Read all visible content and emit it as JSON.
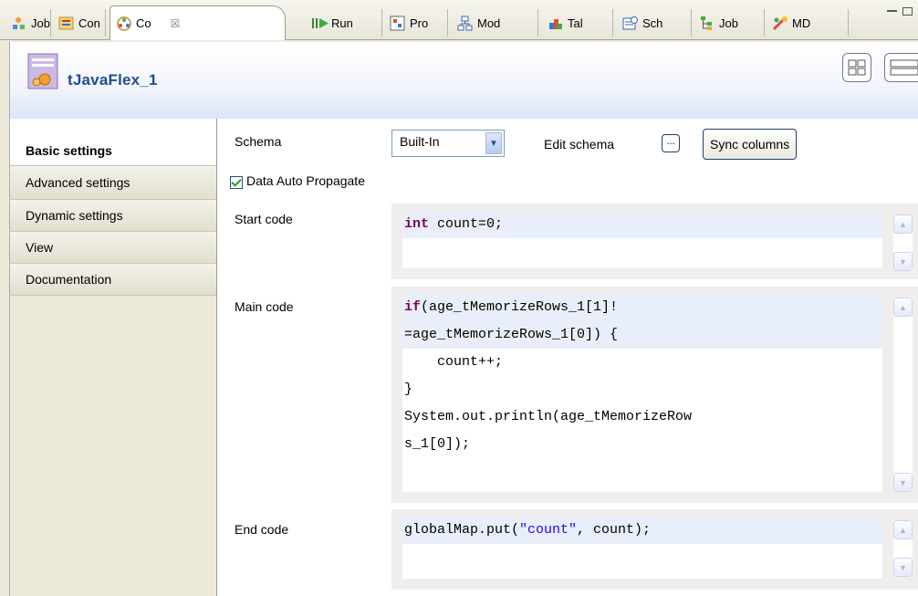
{
  "tabs": [
    {
      "label": "Job",
      "icon": "job-icon"
    },
    {
      "label": "Con",
      "icon": "contexts-icon"
    },
    {
      "label": "Co",
      "icon": "component-icon",
      "active": true
    },
    {
      "label": "Run",
      "icon": "run-icon"
    },
    {
      "label": "Pro",
      "icon": "problems-icon"
    },
    {
      "label": "Mod",
      "icon": "modules-icon"
    },
    {
      "label": "Tal",
      "icon": "talend-icon"
    },
    {
      "label": "Sch",
      "icon": "scheduler-icon"
    },
    {
      "label": "Job",
      "icon": "job-hierarchy-icon"
    },
    {
      "label": "MD",
      "icon": "metadata-icon"
    }
  ],
  "close_symbol": "☒",
  "component": {
    "title": "tJavaFlex_1",
    "icon": "component-gear-icon"
  },
  "nav": {
    "items": [
      {
        "label": "Basic settings",
        "active": true
      },
      {
        "label": "Advanced settings"
      },
      {
        "label": "Dynamic settings"
      },
      {
        "label": "View"
      },
      {
        "label": "Documentation"
      }
    ]
  },
  "basic": {
    "schema_label": "Schema",
    "schema_value": "Built-In",
    "edit_schema_label": "Edit schema",
    "ellipsis": "...",
    "sync_label": "Sync columns",
    "propagate_label": "Data Auto Propagate",
    "propagate_checked": true,
    "start_label": "Start code",
    "main_label": "Main code",
    "end_label": "End code"
  },
  "code": {
    "start": [
      "int count=0;"
    ],
    "main": [
      "if(age_tMemorizeRows_1[1]!",
      "=age_tMemorizeRows_1[0]) {",
      "    count++;",
      "}",
      "System.out.println(age_tMemorizeRow",
      "s_1[0]);"
    ],
    "end": [
      "globalMap.put(\"count\", count);"
    ]
  },
  "colors": {
    "keyword": "#7f0055",
    "string": "#2a00ff",
    "title": "#1f4c8f"
  }
}
